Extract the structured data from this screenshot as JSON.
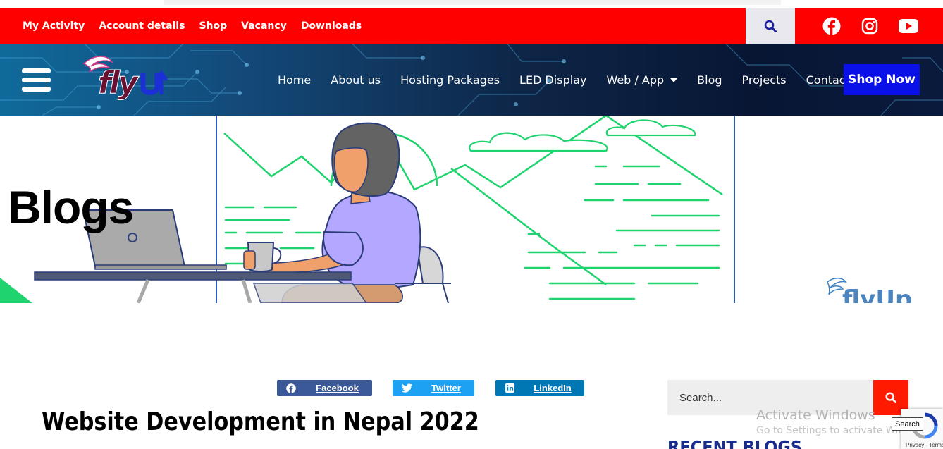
{
  "colors": {
    "topbar": "#ff0000",
    "header_dark": "#0e2648",
    "shop_now": "#0a10e8",
    "facebook": "#3b5998",
    "twitter": "#1da1f2",
    "linkedin": "#0077b5",
    "search_btn": "#ff1a00",
    "recent_heading": "#1a2d8c"
  },
  "topbar": {
    "links": [
      "My Activity",
      "Account details",
      "Shop",
      "Vacancy",
      "Downloads"
    ],
    "search_icon": "search-icon",
    "social": [
      "facebook-icon",
      "instagram-icon",
      "youtube-icon"
    ]
  },
  "header": {
    "logo_text": "flyUp",
    "nav": [
      "Home",
      "About us",
      "Hosting Packages",
      "LED Display",
      "Web / App",
      "Blog",
      "Projects",
      "Contact"
    ],
    "shop_now": "Shop Now"
  },
  "hero": {
    "title": "Blogs",
    "watermark_logo": "flyUp"
  },
  "share": {
    "facebook": "Facebook",
    "twitter": "Twitter",
    "linkedin": "LinkedIn"
  },
  "post": {
    "title": "Website Development in Nepal 2022"
  },
  "sidebar": {
    "search_placeholder": "Search...",
    "recent_heading": "RECENT BLOGS"
  },
  "windows": {
    "line1": "Activate Windows",
    "line2": "Go to Settings to activate Windows."
  },
  "recaptcha": {
    "tooltip": "Search",
    "footer": "Privacy - Terms"
  }
}
